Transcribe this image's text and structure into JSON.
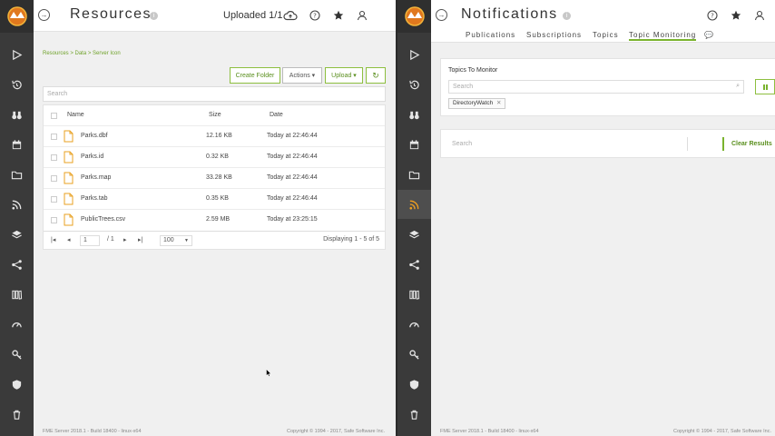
{
  "left": {
    "title": "Resources",
    "uploaded": "Uploaded 1/1",
    "breadcrumb": "Resources > Data > Server Icon",
    "buttons": {
      "create_folder": "Create Folder",
      "actions": "Actions ▾",
      "upload": "Upload ▾",
      "refresh": "↻"
    },
    "search_placeholder": "Search",
    "columns": {
      "name": "Name",
      "size": "Size",
      "date": "Date"
    },
    "files": [
      {
        "name": "Parks.dbf",
        "size": "12.16 KB",
        "date": "Today at 22:46:44"
      },
      {
        "name": "Parks.id",
        "size": "0.32 KB",
        "date": "Today at 22:46:44"
      },
      {
        "name": "Parks.map",
        "size": "33.28 KB",
        "date": "Today at 22:46:44"
      },
      {
        "name": "Parks.tab",
        "size": "0.35 KB",
        "date": "Today at 22:46:44"
      },
      {
        "name": "PublicTrees.csv",
        "size": "2.59 MB",
        "date": "Today at 23:25:15"
      }
    ],
    "pager": {
      "page": "1",
      "of": "/ 1",
      "per_page": "100",
      "display": "Displaying 1 - 5 of 5"
    },
    "footer_left": "FME Server 2018.1 - Build 18400 - linux-x64",
    "footer_right": "Copyright © 1994 - 2017, Safe Software Inc."
  },
  "right": {
    "title": "Notifications",
    "tabs": [
      "Publications",
      "Subscriptions",
      "Topics",
      "Topic Monitoring"
    ],
    "topics_label": "Topics To Monitor",
    "search_placeholder": "Search",
    "chip": "DirectoryWatch",
    "results_search_placeholder": "Search",
    "clear_results": "Clear Results",
    "footer_left": "FME Server 2018.1 - Build 18400 - linux-x64",
    "footer_right": "Copyright © 1994 - 2017, Safe Software Inc."
  },
  "colors": {
    "accent": "#7ab32e",
    "rail": "#3a3a3a",
    "icon_active": "#f0a020"
  }
}
